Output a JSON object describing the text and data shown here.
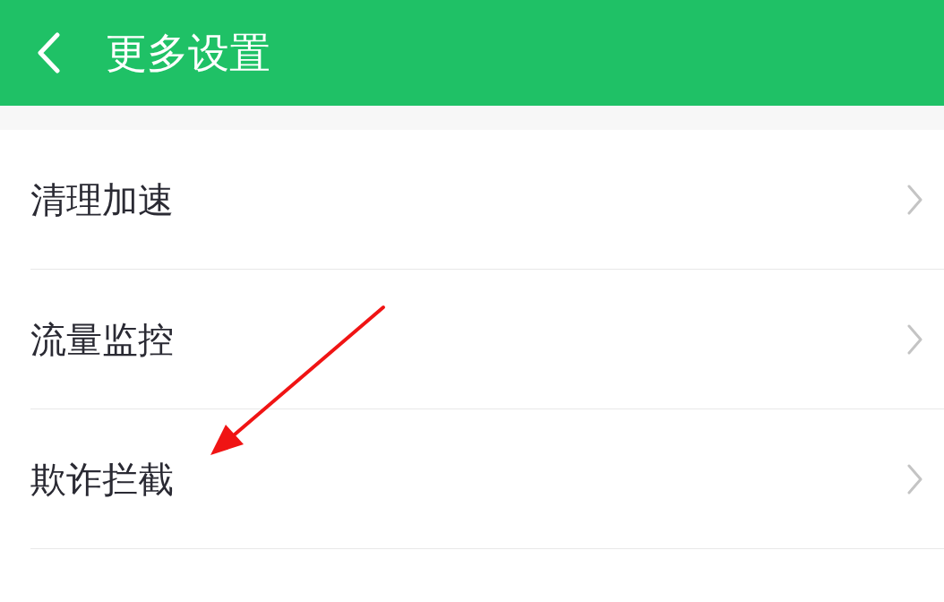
{
  "header": {
    "title": "更多设置"
  },
  "items": [
    {
      "label": "清理加速"
    },
    {
      "label": "流量监控"
    },
    {
      "label": "欺诈拦截"
    }
  ]
}
